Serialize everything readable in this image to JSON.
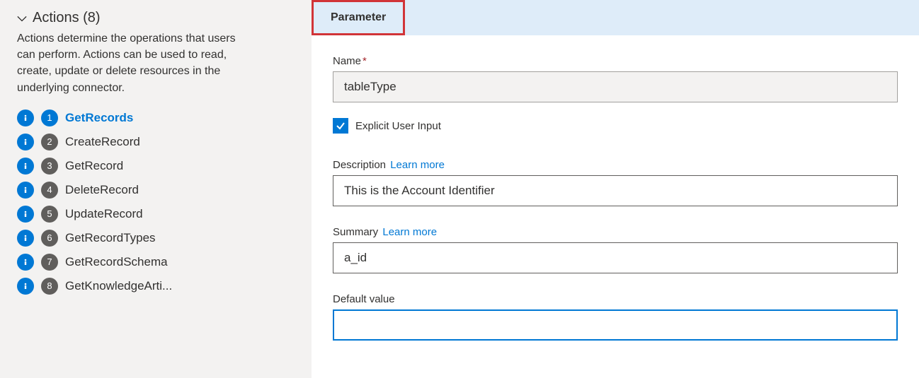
{
  "sidebar": {
    "header": "Actions (8)",
    "description": "Actions determine the operations that users can perform. Actions can be used to read, create, update or delete resources in the underlying connector.",
    "actions": [
      {
        "num": "1",
        "label": "GetRecords",
        "active": true
      },
      {
        "num": "2",
        "label": "CreateRecord",
        "active": false
      },
      {
        "num": "3",
        "label": "GetRecord",
        "active": false
      },
      {
        "num": "4",
        "label": "DeleteRecord",
        "active": false
      },
      {
        "num": "5",
        "label": "UpdateRecord",
        "active": false
      },
      {
        "num": "6",
        "label": "GetRecordTypes",
        "active": false
      },
      {
        "num": "7",
        "label": "GetRecordSchema",
        "active": false
      },
      {
        "num": "8",
        "label": "GetKnowledgeArti...",
        "active": false
      }
    ]
  },
  "tabs": {
    "parameter": "Parameter"
  },
  "form": {
    "name_label": "Name",
    "name_value": "tableType",
    "explicit_label": "Explicit User Input",
    "description_label": "Description",
    "description_value": "This is the Account Identifier",
    "summary_label": "Summary",
    "summary_value": "a_id",
    "default_label": "Default value",
    "default_value": "",
    "learn_more": "Learn more"
  }
}
